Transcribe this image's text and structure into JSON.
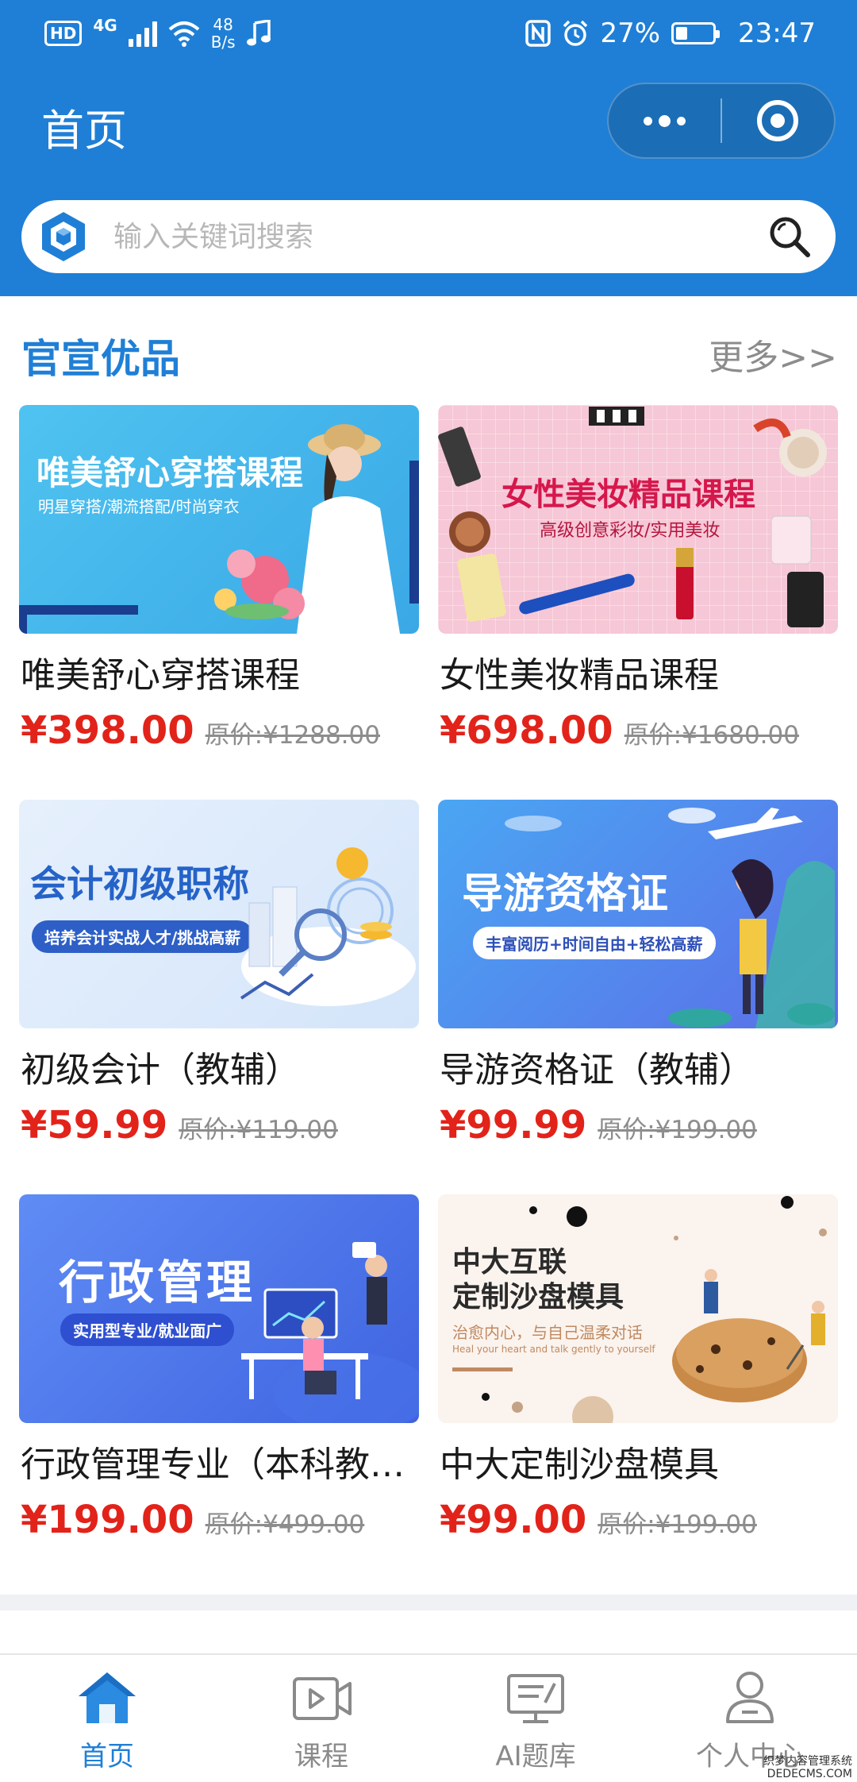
{
  "status_bar": {
    "hd": "HD",
    "network": "4G",
    "speed_value": "48",
    "speed_unit": "B/s",
    "battery": "27%",
    "time": "23:47",
    "battery_level": 0.27
  },
  "nav": {
    "title": "首页",
    "menu_icon": "more-dots-icon",
    "close_icon": "target-close-icon"
  },
  "search": {
    "placeholder": "输入关键词搜索",
    "value": "",
    "logo_icon": "cube-logo-icon",
    "search_icon": "magnifier-icon"
  },
  "section": {
    "title": "官宣优品",
    "more": "更多>>"
  },
  "products": [
    {
      "banner": {
        "title": "唯美舒心穿搭课程",
        "subtitle": "明星穿搭/潮流搭配/时尚穿衣"
      },
      "title": "唯美舒心穿搭课程",
      "price": "¥398.00",
      "original_price": "原价:¥1288.00"
    },
    {
      "banner": {
        "title": "女性美妆精品课程",
        "subtitle": "高级创意彩妆/实用美妆"
      },
      "title": "女性美妆精品课程",
      "price": "¥698.00",
      "original_price": "原价:¥1680.00"
    },
    {
      "banner": {
        "title": "会计初级职称",
        "subtitle": "培养会计实战人才/挑战高薪"
      },
      "title": "初级会计（教辅）",
      "price": "¥59.99",
      "original_price": "原价:¥119.00"
    },
    {
      "banner": {
        "title": "导游资格证",
        "subtitle": "丰富阅历+时间自由+轻松高薪"
      },
      "title": "导游资格证（教辅）",
      "price": "¥99.99",
      "original_price": "原价:¥199.00"
    },
    {
      "banner": {
        "title": "行政管理",
        "subtitle": "实用型专业/就业面广"
      },
      "title": "行政管理专业（本科教辅）",
      "price": "¥199.00",
      "original_price": "原价:¥499.00"
    },
    {
      "banner": {
        "title_line1": "中大互联",
        "title_line2": "定制沙盘模具",
        "subtitle": "治愈内心，与自己温柔对话",
        "subtitle_en": "Heal your heart and talk gently to yourself"
      },
      "title": "中大定制沙盘模具",
      "price": "¥99.00",
      "original_price": "原价:¥199.00"
    }
  ],
  "tabbar": [
    {
      "label": "首页",
      "icon": "home-icon",
      "active": true
    },
    {
      "label": "课程",
      "icon": "video-icon",
      "active": false
    },
    {
      "label": "AI题库",
      "icon": "question-bank-icon",
      "active": false
    },
    {
      "label": "个人中心",
      "icon": "user-icon",
      "active": false
    }
  ],
  "watermark": {
    "line1": "织梦内容管理系统",
    "line2": "DEDECMS.COM"
  },
  "colors": {
    "brand_blue": "#1f7fd6",
    "price_red": "#e2231a",
    "muted_gray": "#8d8d8d"
  }
}
